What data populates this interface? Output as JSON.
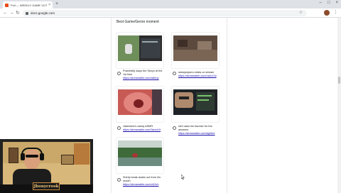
{
  "browser": {
    "tab_title": "Poll — WEEKLY GAME VOTE ✕",
    "url": "docs.google.com"
  },
  "form": {
    "question": "Best Game/Genre moment",
    "options": [
      {
        "text": "Pokelekity slays the Skeyn at the 1st time",
        "link": "https://streamable.com/wfkrnp"
      },
      {
        "text": "stokepolpers exists on stream",
        "link": "https://streamable.com/ms1e7w"
      },
      {
        "text": "Jakendub's candy ASMR",
        "link": "https://streamable.com/3smn19"
      },
      {
        "text": "rsDr asks his founder for the answers",
        "link": "https://streamable.com/kgb6xx"
      },
      {
        "text": "Shinly beats dudes out from his mouth",
        "link": "https://streamable.com/v4l1vh"
      }
    ]
  },
  "webcam": {
    "name": "Jhonycrook"
  }
}
